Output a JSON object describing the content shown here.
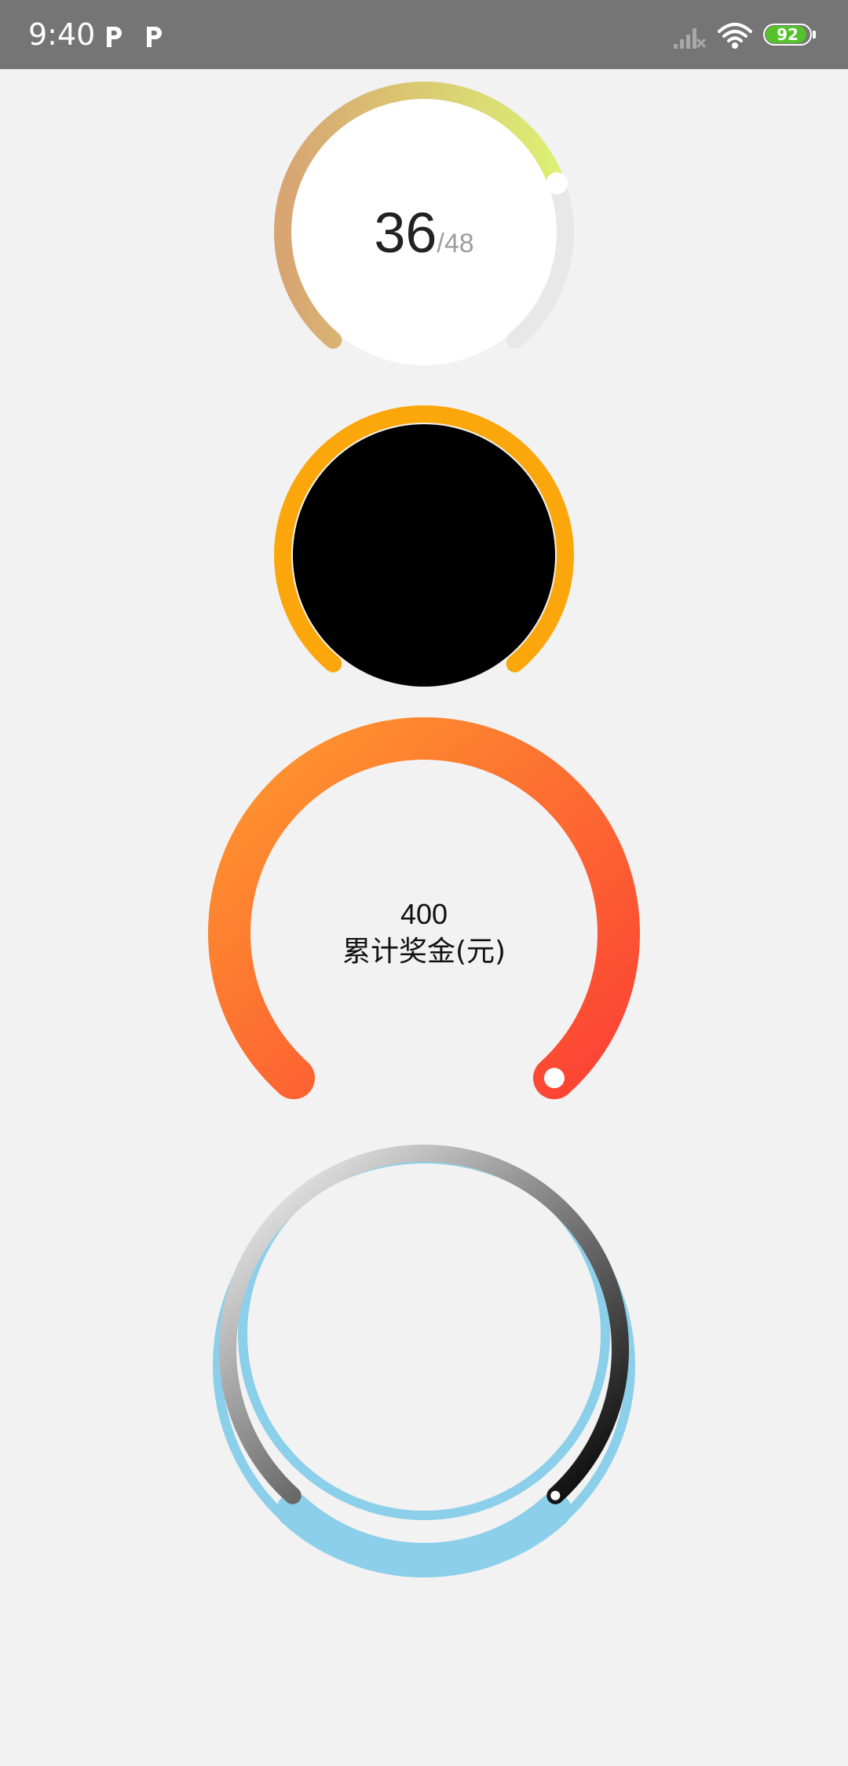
{
  "status_bar": {
    "time": "9:40",
    "battery_level": "92",
    "battery_fill_fraction": 0.92,
    "icons": [
      "parking-p-icon",
      "parking-p-icon",
      "signal-icon",
      "wifi-icon",
      "battery-icon"
    ]
  },
  "gauges": [
    {
      "id": "gauge-1",
      "value": "36",
      "separator": "/",
      "total": "48",
      "progress_fraction": 0.75,
      "colors": {
        "start": "#d8a472",
        "end": "#dcef73",
        "track": "#e8e8e8",
        "face": "#ffffff",
        "knob": "#ffffff"
      }
    },
    {
      "id": "gauge-2",
      "progress_fraction": 1.0,
      "colors": {
        "arc": "#fba60a",
        "track": "#ffffff",
        "face": "#000000"
      }
    },
    {
      "id": "gauge-3",
      "value": "400",
      "label": "累计奖金(元)",
      "progress_fraction": 1.0,
      "colors": {
        "start": "#fe9a2e",
        "end": "#fc4134",
        "track": "#eeeeee",
        "knob": "#ffffff"
      }
    },
    {
      "id": "gauge-4",
      "progress_fraction": 1.0,
      "colors": {
        "ring": "#8ccfea",
        "start": "#ffffff",
        "end": "#000000",
        "knob": "#ffffff"
      }
    }
  ]
}
